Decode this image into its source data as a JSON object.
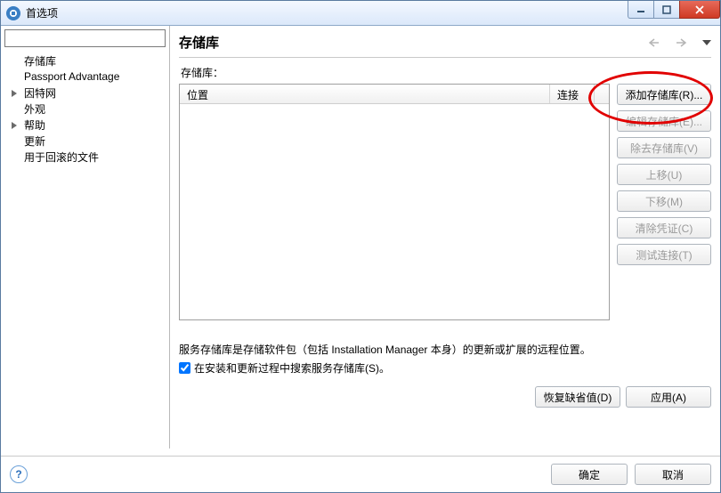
{
  "window": {
    "title": "首选项"
  },
  "sidebar": {
    "filter_value": "",
    "items": [
      {
        "label": "存储库",
        "expandable": false
      },
      {
        "label": "Passport Advantage",
        "expandable": false
      },
      {
        "label": "因特网",
        "expandable": true
      },
      {
        "label": "外观",
        "expandable": false
      },
      {
        "label": "帮助",
        "expandable": true
      },
      {
        "label": "更新",
        "expandable": false
      },
      {
        "label": "用于回滚的文件",
        "expandable": false
      }
    ]
  },
  "main": {
    "title": "存储库",
    "section_label": "存储库：",
    "columns": {
      "location": "位置",
      "connection": "连接"
    },
    "buttons": {
      "add": "添加存储库(R)...",
      "edit": "编辑存储库(E)...",
      "remove": "除去存储库(V)",
      "up": "上移(U)",
      "down": "下移(M)",
      "clear": "清除凭证(C)",
      "test": "测试连接(T)"
    },
    "description": "服务存储库是存储软件包（包括 Installation Manager 本身）的更新或扩展的远程位置。",
    "checkbox_label": "在安装和更新过程中搜索服务存储库(S)。",
    "checkbox_checked": true,
    "restore": "恢复缺省值(D)",
    "apply": "应用(A)"
  },
  "footer": {
    "ok": "确定",
    "cancel": "取消"
  }
}
